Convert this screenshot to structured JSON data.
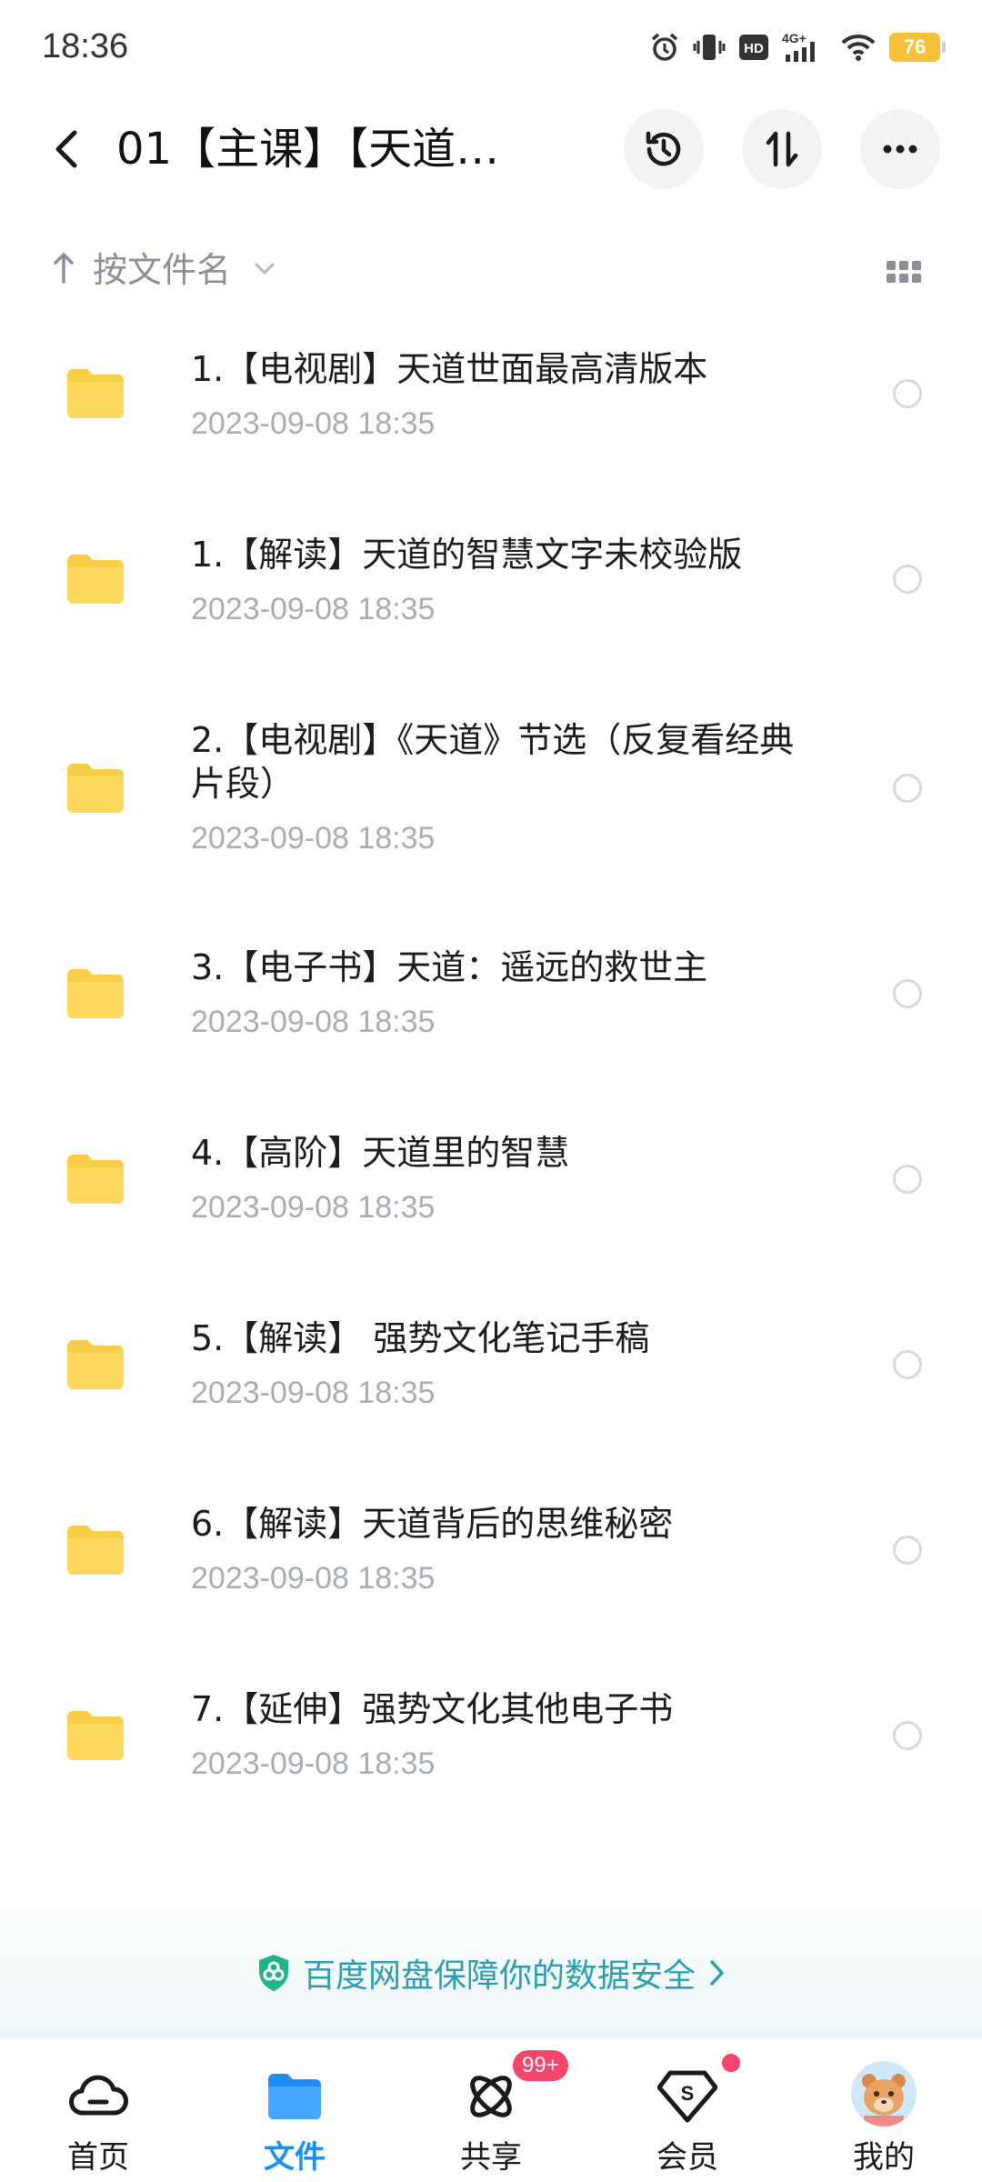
{
  "status_bar": {
    "time": "18:36",
    "network": "4G+",
    "hd": "HD",
    "battery": "76",
    "icons": [
      "alarm-icon",
      "vibrate-icon",
      "hd-icon",
      "signal-icon",
      "wifi-icon",
      "battery-icon"
    ]
  },
  "header": {
    "title": "01【主课】【天道…",
    "buttons": [
      "history-icon",
      "sort-order-icon",
      "more-icon"
    ]
  },
  "sort": {
    "label": "按文件名"
  },
  "files": [
    {
      "name": "1.【电视剧】天道世面最高清版本",
      "date": "2023-09-08  18:35"
    },
    {
      "name": "1.【解读】天道的智慧文字未校验版",
      "date": "2023-09-08  18:35"
    },
    {
      "name": "2.【电视剧】《天道》节选（反复看经典片段）",
      "date": "2023-09-08  18:35"
    },
    {
      "name": "3.【电子书】天道：遥远的救世主",
      "date": "2023-09-08  18:35"
    },
    {
      "name": "4.【高阶】天道里的智慧",
      "date": "2023-09-08  18:35"
    },
    {
      "name": "5.【解读】 强势文化笔记手稿",
      "date": "2023-09-08  18:35"
    },
    {
      "name": "6.【解读】天道背后的思维秘密",
      "date": "2023-09-08  18:35"
    },
    {
      "name": "7.【延伸】强势文化其他电子书",
      "date": "2023-09-08  18:35"
    }
  ],
  "banner": {
    "text": "百度网盘保障你的数据安全"
  },
  "nav": {
    "items": [
      {
        "label": "首页",
        "icon": "cloud-icon"
      },
      {
        "label": "文件",
        "icon": "folder-icon"
      },
      {
        "label": "共享",
        "icon": "share-atom-icon"
      },
      {
        "label": "会员",
        "icon": "vip-diamond-icon"
      },
      {
        "label": "我的",
        "icon": "avatar"
      }
    ],
    "share_badge": "99+"
  },
  "colors": {
    "accent": "#1d8ef5",
    "folder": "#f9cf4a",
    "banner_text": "#2a9fb0",
    "badge": "#f4466a"
  }
}
